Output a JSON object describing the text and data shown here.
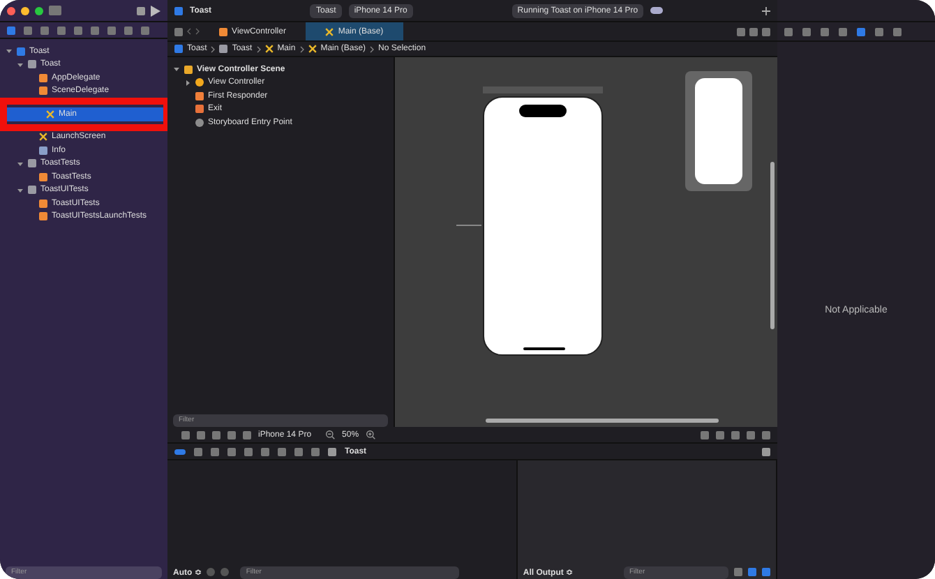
{
  "window": {
    "title": "Toast",
    "scheme": "Toast",
    "device": "iPhone 14 Pro",
    "status": "Running Toast on iPhone 14 Pro"
  },
  "navigator": {
    "items": [
      {
        "label": "Toast",
        "kind": "project",
        "selected": false,
        "expanded": true,
        "children": [
          {
            "label": "Toast",
            "kind": "folder",
            "selected": false,
            "expanded": true,
            "children": [
              {
                "label": "AppDelegate",
                "kind": "swift",
                "selected": false
              },
              {
                "label": "SceneDelegate",
                "kind": "swift",
                "selected": false
              },
              {
                "label": "Main",
                "kind": "storyboard",
                "selected": true,
                "highlighted": true
              },
              {
                "label": "LaunchScreen",
                "kind": "storyboard",
                "selected": false
              },
              {
                "label": "Info",
                "kind": "plist",
                "selected": false
              }
            ]
          },
          {
            "label": "ToastTests",
            "kind": "folder",
            "selected": false,
            "expanded": true,
            "children": [
              {
                "label": "ToastTests",
                "kind": "swift",
                "selected": false
              }
            ]
          },
          {
            "label": "ToastUITests",
            "kind": "folder",
            "selected": false,
            "expanded": true,
            "children": [
              {
                "label": "ToastUITests",
                "kind": "swift",
                "selected": false
              },
              {
                "label": "ToastUITestsLaunchTests",
                "kind": "swift",
                "selected": false
              }
            ]
          }
        ]
      }
    ],
    "filter_placeholder": "Filter"
  },
  "editor_tabs": [
    {
      "label": "ViewController",
      "kind": "swift",
      "selected": false
    },
    {
      "label": "Main (Base)",
      "kind": "storyboard",
      "selected": true
    }
  ],
  "breadcrumb": [
    {
      "label": "Toast",
      "kind": "project"
    },
    {
      "label": "Toast",
      "kind": "folder"
    },
    {
      "label": "Main",
      "kind": "storyboard"
    },
    {
      "label": "Main (Base)",
      "kind": "storyboard"
    },
    {
      "label": "No Selection",
      "kind": "none"
    }
  ],
  "outline": {
    "items": [
      {
        "label": "View Controller Scene",
        "kind": "scene",
        "expanded": true,
        "children": [
          {
            "label": "View Controller",
            "kind": "controller",
            "expanded": false
          },
          {
            "label": "First Responder",
            "kind": "responder"
          },
          {
            "label": "Exit",
            "kind": "exit"
          },
          {
            "label": "Storyboard Entry Point",
            "kind": "entry"
          }
        ]
      }
    ],
    "filter_placeholder": "Filter"
  },
  "canvas_bar": {
    "device": "iPhone 14 Pro",
    "zoom": "50%"
  },
  "debug_bar": {
    "target": "Toast"
  },
  "variables": {
    "scope": "Auto ≎",
    "filter_placeholder": "Filter"
  },
  "console": {
    "scope": "All Output ≎",
    "filter_placeholder": "Filter"
  },
  "inspector": {
    "message": "Not Applicable"
  }
}
